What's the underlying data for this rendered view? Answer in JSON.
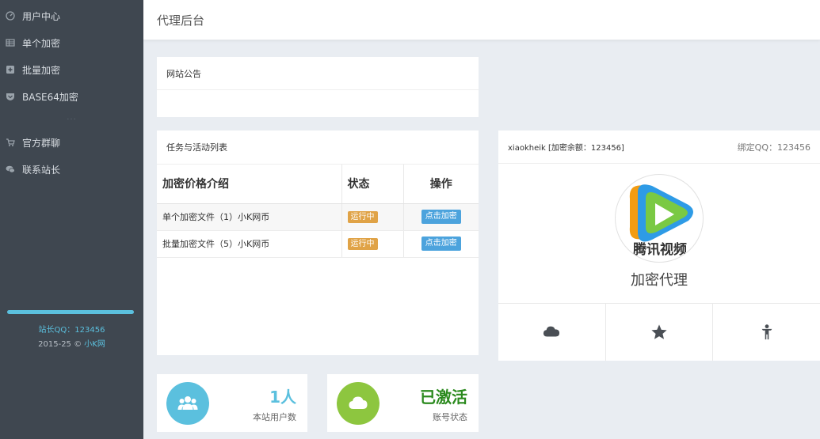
{
  "sidebar": {
    "items": [
      {
        "label": "用户中心",
        "icon": "dashboard-icon"
      },
      {
        "label": "单个加密",
        "icon": "table-icon"
      },
      {
        "label": "批量加密",
        "icon": "plus-square-icon"
      },
      {
        "label": "BASE64加密",
        "icon": "shield-icon"
      }
    ],
    "separator": "···",
    "items2": [
      {
        "label": "官方群聊",
        "icon": "cart-icon"
      },
      {
        "label": "联系站长",
        "icon": "chat-icon"
      }
    ],
    "footer": {
      "qq": "站长QQ：123456",
      "copyright_prefix": "2015-25 © ",
      "brand": "小K网"
    }
  },
  "header": {
    "title": "代理后台"
  },
  "notice": {
    "title": "网站公告"
  },
  "tasks": {
    "title": "任务与活动列表",
    "columns": [
      "加密价格介绍",
      "状态",
      "操作"
    ],
    "rows": [
      {
        "desc": "单个加密文件（1）小K网币",
        "status": "运行中",
        "action": "点击加密"
      },
      {
        "desc": "批量加密文件（5）小K网币",
        "status": "运行中",
        "action": "点击加密"
      }
    ]
  },
  "profile": {
    "user": "xiaokheik [加密余额：123456]",
    "qq": "绑定QQ：123456",
    "avatar_text": "腾讯视频",
    "role": "加密代理",
    "actions": [
      "cloud-icon",
      "star-icon",
      "user-icon"
    ]
  },
  "stats": [
    {
      "value": "1人",
      "label": "本站用户数",
      "icon": "users-icon",
      "color": "#5bc0de",
      "value_color": "#5bc0de"
    },
    {
      "value": "已激活",
      "label": "账号状态",
      "icon": "cloud-icon",
      "color": "#8dc63f",
      "value_color": "#2b8a1e"
    }
  ],
  "colors": {
    "sidebar": "#3f4750",
    "accent": "#5bc0de",
    "badge": "#e0a347",
    "button": "#4ca3dd"
  }
}
